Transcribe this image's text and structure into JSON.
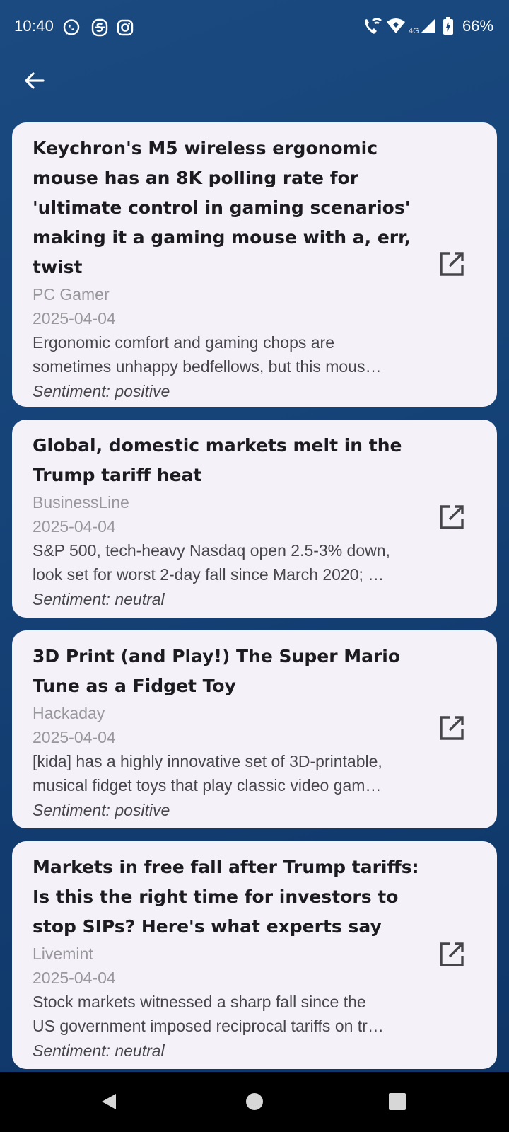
{
  "status_bar": {
    "time": "10:40",
    "battery": "66%",
    "network": "4G",
    "left_icons": [
      "whatsapp-icon",
      "s-app-icon",
      "instagram-icon"
    ],
    "right_icons": [
      "wifi-call-icon",
      "wifi-icon",
      "signal-icon",
      "battery-icon"
    ]
  },
  "toolbar": {
    "back_icon": "arrow-left-icon"
  },
  "articles": [
    {
      "title": "Keychron's M5 wireless ergonomic mouse has an 8K polling rate for 'ultimate control in gaming scenarios' making it a gaming mouse with a, err, twist",
      "source": "PC Gamer",
      "date": "2025-04-04",
      "summary_line1": "Ergonomic comfort and gaming chops are",
      "summary_line2": "sometimes unhappy bedfellows, but this mous…",
      "sentiment": "Sentiment: positive"
    },
    {
      "title": "Global, domestic markets melt in the Trump tariff heat",
      "source": "BusinessLine",
      "date": "2025-04-04",
      "summary_line1": "S&P 500, tech-heavy Nasdaq open 2.5-3% down,",
      "summary_line2": "look set for worst 2-day fall since March 2020; …",
      "sentiment": "Sentiment: neutral"
    },
    {
      "title": "3D Print (and Play!) The Super Mario Tune as a Fidget Toy",
      "source": "Hackaday",
      "date": "2025-04-04",
      "summary_line1": "[kida] has a highly innovative set of 3D-printable,",
      "summary_line2": "musical fidget toys that play classic video gam…",
      "sentiment": "Sentiment: positive"
    },
    {
      "title": "Markets in free fall after Trump tariffs: Is this the right time for investors to stop SIPs? Here's what experts say",
      "source": "Livemint",
      "date": "2025-04-04",
      "summary_line1": "Stock markets witnessed a sharp fall since the",
      "summary_line2": "US government imposed reciprocal tariffs on tr…",
      "sentiment": "Sentiment: neutral"
    }
  ],
  "colors": {
    "background": "#164479",
    "card": "#f4f2f8",
    "title": "#1c1b1f",
    "meta": "#98979c",
    "body": "#47464b"
  },
  "nav_bar": {
    "icons": [
      "back-triangle-icon",
      "home-circle-icon",
      "recents-square-icon"
    ]
  }
}
